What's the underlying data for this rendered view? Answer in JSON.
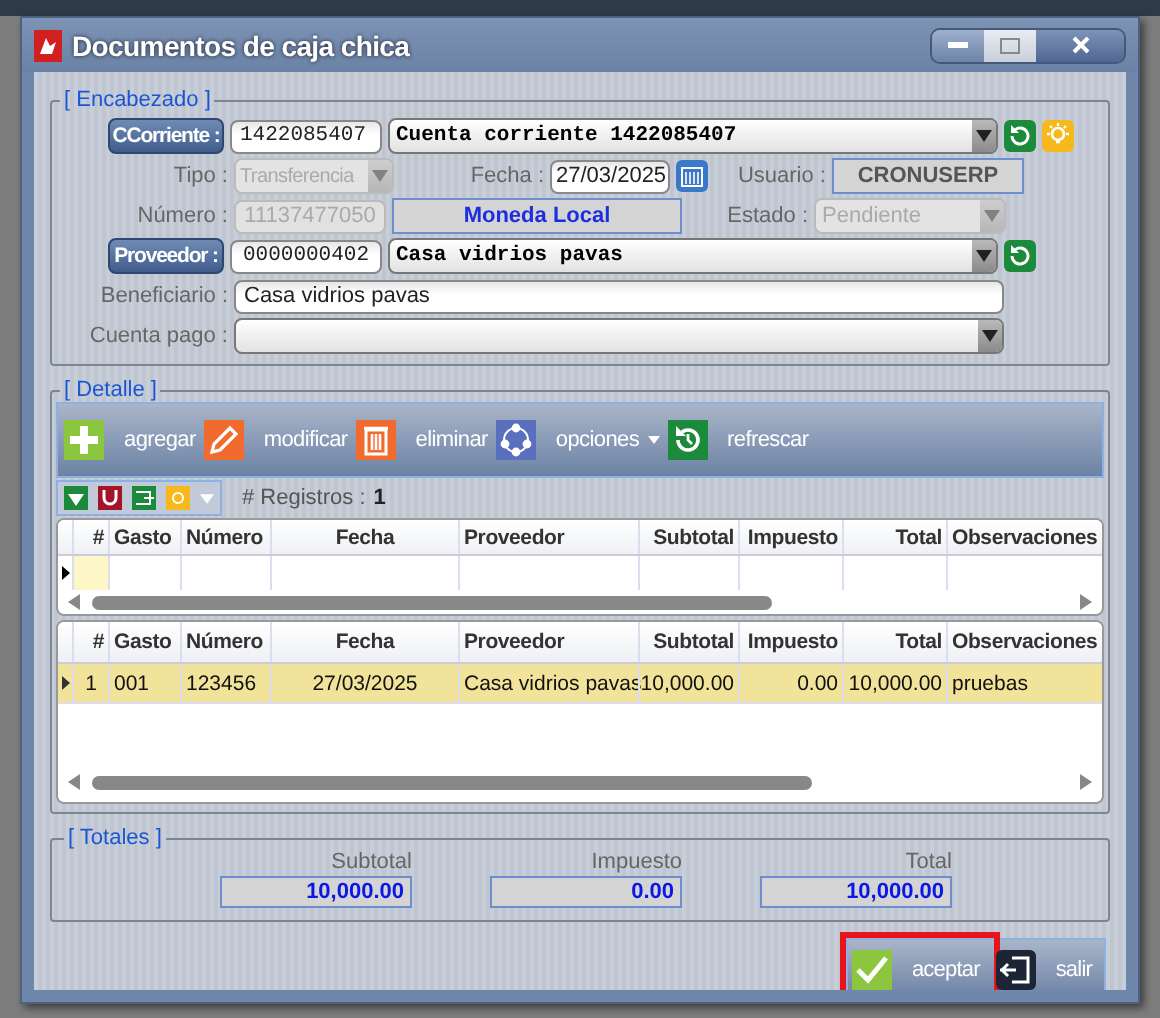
{
  "window": {
    "title": "Documentos de caja chica"
  },
  "header": {
    "title": "[ Encabezado ]",
    "ccorriente": {
      "label": "CCorriente :",
      "code": "1422085407",
      "name": "Cuenta corriente 1422085407"
    },
    "tipo": {
      "label": "Tipo :",
      "value": "Transferencia",
      "disabled": true
    },
    "fecha": {
      "label": "Fecha :",
      "value": "27/03/2025"
    },
    "usuario": {
      "label": "Usuario :",
      "value": "CRONUSERP"
    },
    "numero": {
      "label": "Número :",
      "value": "11137477050",
      "disabled": true
    },
    "moneda": "Moneda Local",
    "estado": {
      "label": "Estado :",
      "value": "Pendiente",
      "disabled": true
    },
    "proveedor": {
      "label": "Proveedor :",
      "code": "0000000402",
      "name": "Casa vidrios pavas"
    },
    "beneficiario": {
      "label": "Beneficiario :",
      "value": "Casa vidrios pavas"
    },
    "cuenta_pago": {
      "label": "Cuenta pago :"
    }
  },
  "detail": {
    "title": "[ Detalle ]",
    "toolbar": [
      {
        "label": "agregar",
        "kind": "add"
      },
      {
        "label": "modificar",
        "kind": "edit"
      },
      {
        "label": "eliminar",
        "kind": "delete"
      },
      {
        "label": "opciones",
        "kind": "options"
      },
      {
        "label": "refrescar",
        "kind": "refresh"
      }
    ],
    "records_label": "# Registros :",
    "records_count": "1",
    "entry_columns": [
      "#",
      "Gasto",
      "Número",
      "Fecha",
      "Proveedor",
      "Subtotal",
      "Impuesto",
      "Total",
      "Observaciones"
    ],
    "columns": [
      "#",
      "Gasto",
      "Número",
      "Fecha",
      "Proveedor",
      "Subtotal",
      "Impuesto",
      "Total",
      "Observaciones"
    ],
    "rows": [
      {
        "cells": [
          "1",
          "001",
          "123456",
          "27/03/2025",
          "Casa vidrios pavas",
          "10,000.00",
          "0.00",
          "10,000.00",
          "pruebas"
        ],
        "selected": true
      }
    ]
  },
  "totals": {
    "title": "[ Totales ]",
    "items": [
      {
        "label": "Subtotal",
        "value": "10,000.00"
      },
      {
        "label": "Impuesto",
        "value": "0.00"
      },
      {
        "label": "Total",
        "value": "10,000.00"
      }
    ]
  },
  "buttons": [
    {
      "label": "aceptar",
      "kind": "accept",
      "highlighted": true
    },
    {
      "label": "salir",
      "kind": "exit",
      "highlighted": false
    }
  ]
}
